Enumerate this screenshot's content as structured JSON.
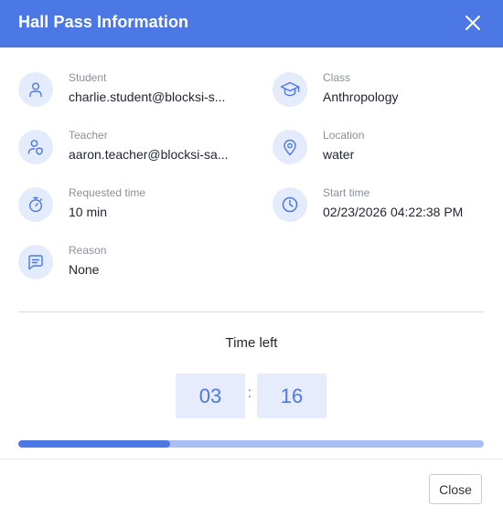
{
  "header": {
    "title": "Hall Pass Information",
    "close_icon": "close-icon"
  },
  "fields": {
    "student": {
      "label": "Student",
      "value": "charlie.student@blocksi-s...",
      "icon": "user-icon"
    },
    "class": {
      "label": "Class",
      "value": "Anthropology",
      "icon": "graduation-cap-icon"
    },
    "teacher": {
      "label": "Teacher",
      "value": "aaron.teacher@blocksi-sa...",
      "icon": "user-shield-icon"
    },
    "location": {
      "label": "Location",
      "value": "water",
      "icon": "map-pin-icon"
    },
    "requested_time": {
      "label": "Requested time",
      "value": "10 min",
      "icon": "stopwatch-icon"
    },
    "start_time": {
      "label": "Start time",
      "value": "02/23/2026 04:22:38 PM",
      "icon": "clock-icon"
    },
    "reason": {
      "label": "Reason",
      "value": "None",
      "icon": "chat-icon"
    }
  },
  "timer": {
    "label": "Time left",
    "minutes": "03",
    "separator": ":",
    "seconds": "16",
    "progress_fraction": 0.326
  },
  "footer": {
    "close_label": "Close"
  },
  "colors": {
    "accent": "#4c78e6",
    "icon_bg": "#e4ebfb",
    "progress_track": "#a9bff3"
  }
}
